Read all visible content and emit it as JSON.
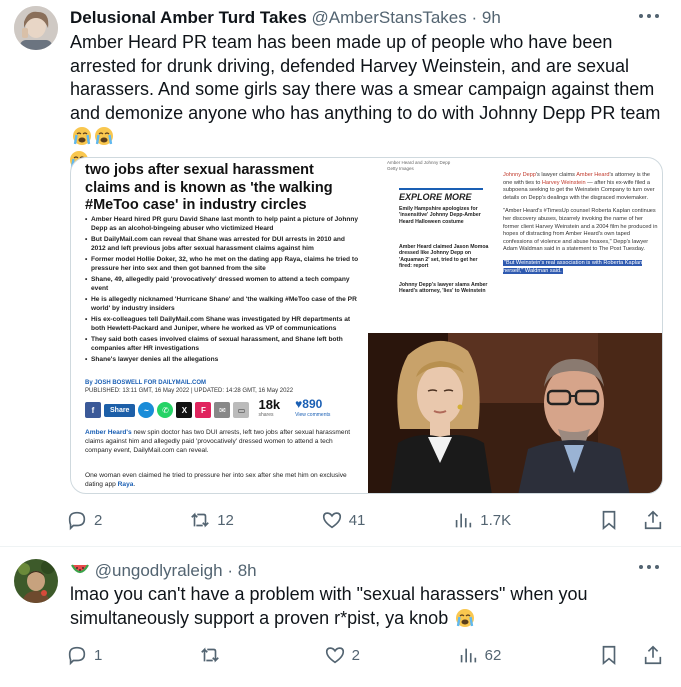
{
  "tweet1": {
    "name": "Delusional Amber Turd Takes",
    "handle": "@AmberStansTakes",
    "time": "· 9h",
    "text": "Amber Heard PR team has been made up of people who have been arrested for drunk driving, defended Harvey Weinstein, and are sexual harassers. And some girls say there was a smear campaign against them and demonize anyone who has anything to do with Johnny Depp PR team",
    "emoji": "loudly-crying-face",
    "media": {
      "headline": "two jobs after sexual harassment claims and is known as 'the walking #MeToo case' in industry circles",
      "bullets": [
        "Amber Heard hired PR guru David Shane last month to help paint a picture of Johnny Depp as an alcohol-bingeing abuser who victimized Heard",
        "But DailyMail.com can reveal that Shane was arrested for DUI arrests in 2010 and 2012 and left previous jobs after sexual harassment claims against him",
        "Former model Hollie Doker, 32, who he met on the dating app Raya, claims he tried to pressure her into sex and then got banned from the site",
        "Shane, 49, allegedly paid 'provocatively' dressed women to attend a tech company event",
        "He is allegedly nicknamed 'Hurricane Shane' and 'the walking #MeToo case of the PR world' by industry insiders",
        "His ex-colleagues tell DailyMail.com Shane was investigated by HR departments at both Hewlett-Packard and Juniper, where he worked as VP of communications",
        "They said both cases involved claims of sexual harassment, and Shane left both companies after HR investigations",
        "Shane's lawyer denies all the allegations"
      ],
      "byline": "By JOSH BOSWELL FOR DAILYMAIL.COM",
      "published": "PUBLISHED: 13:11 GMT, 16 May 2022 | UPDATED: 14:28 GMT, 16 May 2022",
      "share_label": "Share",
      "shares_count": "18k",
      "shares_label": "shares",
      "views_count": "♥890",
      "views_label": "View comments",
      "lede_name": "Amber Heard's",
      "lede_rest": " new spin doctor has two DUI arrests, left two jobs after sexual harassment claims against him and allegedly paid 'provocatively' dressed women to attend a tech company event, DailyMail.com can reveal.",
      "lede2_text": "One woman even claimed he tried to pressure her into sex after she met him on exclusive dating app ",
      "lede2_link": "Raya",
      "lede2_end": ".",
      "caption": "Amber Heard and Johnny Depp",
      "caption2": "Getty Images",
      "explore_title": "EXPLORE MORE",
      "explore_items": [
        "Emily Hampshire apologizes for 'insensitive' Johnny Depp-Amber Heard Halloween costume",
        "Amber Heard claimed Jason Momoa dressed like Johnny Depp on 'Aquaman 2' set, tried to get her fired: report",
        "Johnny Depp's lawyer slams Amber Heard's attorney, 'lies' to Weinstein"
      ],
      "right_p1_a": "Johnny Depp",
      "right_p1_b": "'s lawyer claims ",
      "right_p1_c": "Amber Heard",
      "right_p1_d": "'s attorney is the one with ties to ",
      "right_p1_e": "Harvey Weinstein",
      "right_p1_f": " — after his ex-wife filed a subpoena seeking to get the Weinstein Company to turn over details on Depp's dealings with the disgraced moviemaker.",
      "right_p2": "\"Amber Heard's #TimesUp counsel Roberta Kaplan continues her discovery abuses, bizarrely invoking the name of her former client Harvey Weinstein and a 2004 film he produced in hopes of distracting from Amber Heard's own taped confessions of violence and abuse hoaxes,\" Depp's lawyer Adam Waldman said in a statement to The Post Tuesday.",
      "right_highlight": "\"But Weinstein's real association is with Roberta Kaplan herself,\" Waldman said."
    },
    "replies": "2",
    "retweets": "12",
    "likes": "41",
    "views": "1.7K"
  },
  "tweet2": {
    "name_emoji": "watermelon",
    "handle": "@ungodlyraleigh",
    "time": "· 8h",
    "text": "lmao you can't have a problem with \"sexual harassers\" when you simultaneously support a proven r*pist, ya knob",
    "emoji": "loudly-crying-face",
    "replies": "1",
    "retweets": "",
    "likes": "2",
    "views": "62"
  },
  "colors": {
    "text": "#0f1419",
    "secondary": "#536471",
    "border": "#cfd9de",
    "link": "#1a5fb4"
  }
}
